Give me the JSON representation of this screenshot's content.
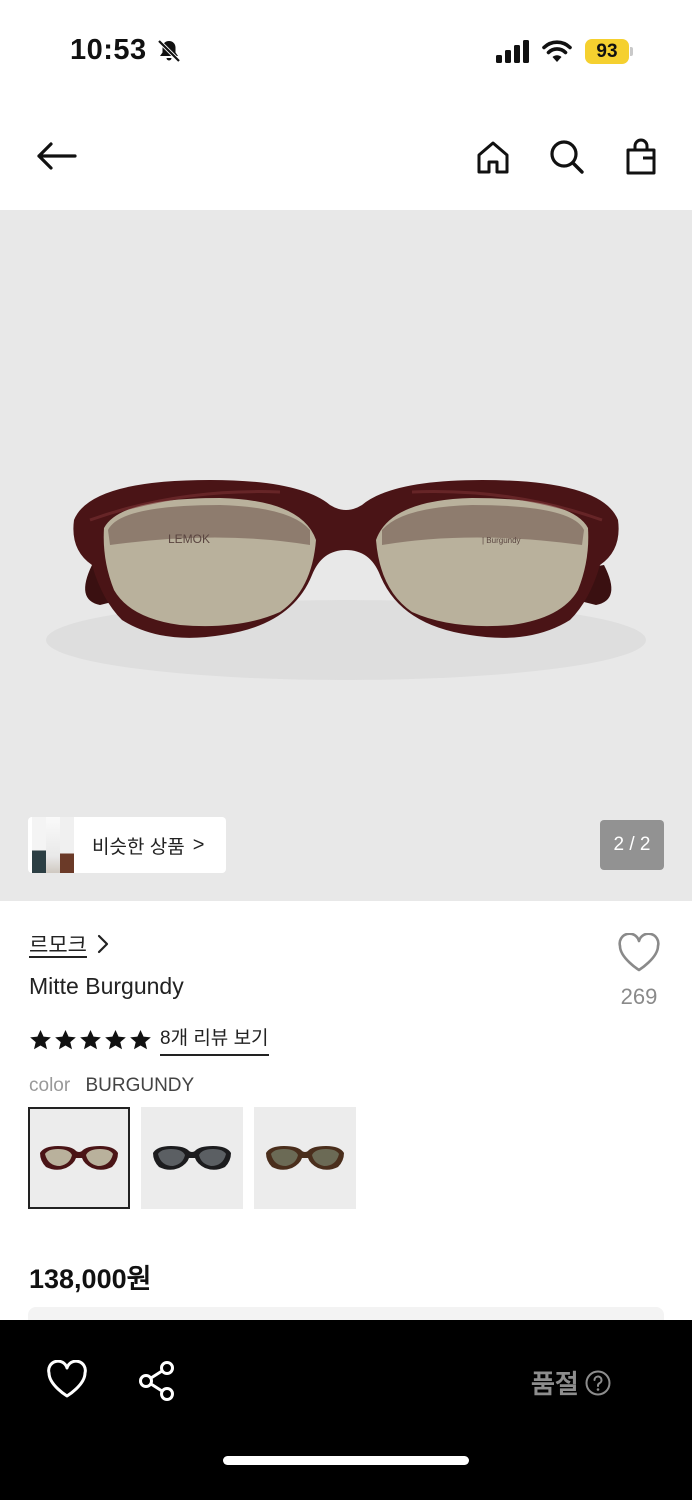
{
  "status_bar": {
    "time": "10:53",
    "battery": "93"
  },
  "nav": {
    "back": "back-arrow-icon",
    "home": "home-icon",
    "search": "search-icon",
    "bag": "shopping-bag-icon"
  },
  "hero": {
    "similar_products_label": "비슷한 상품",
    "similar_chevron": ">",
    "page_indicator": "2 / 2",
    "frame_brand_print": "LEMOK",
    "temple_print": "| Burgundy"
  },
  "product": {
    "brand": "르모크",
    "brand_chevron": ">",
    "name": "Mitte Burgundy",
    "wishlist_count": "269",
    "rating_stars": 5,
    "reviews_link": "8개 리뷰 보기",
    "color_key": "color",
    "color_value": "BURGUNDY",
    "swatches": [
      {
        "color": "#4a1416",
        "selected": true
      },
      {
        "color": "#1c1c1e",
        "selected": false
      },
      {
        "color": "#4a2e1c",
        "selected": false
      }
    ],
    "price": "138,000원"
  },
  "bottom_bar": {
    "soldout_label": "품절"
  },
  "colors": {
    "accent_battery": "#f5d02f",
    "frame": "#4a1416",
    "lens": "#b9b19c",
    "hero_bg": "#e8e8e8"
  }
}
